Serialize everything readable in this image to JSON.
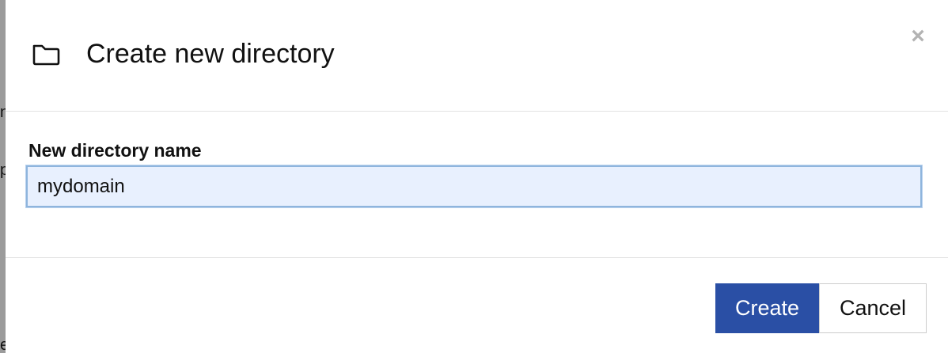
{
  "dialog": {
    "title": "Create new directory",
    "icon": "folder-icon",
    "close_glyph": "×"
  },
  "form": {
    "label": "New directory name",
    "value": "mydomain"
  },
  "buttons": {
    "create": "Create",
    "cancel": "Cancel"
  },
  "colors": {
    "primary": "#2a4fa5",
    "input_bg": "#e8f0fe",
    "input_border": "#8fb5dd"
  }
}
